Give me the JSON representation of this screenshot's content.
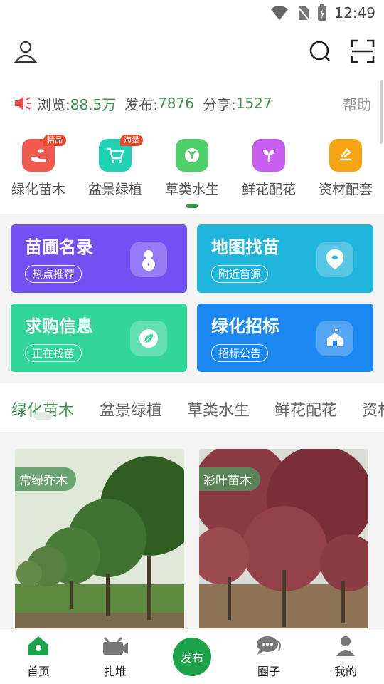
{
  "status": {
    "time": "12:49"
  },
  "stats": {
    "browse_label": "浏览:",
    "browse_value": "88.5万",
    "publish_label": "发布:",
    "publish_value": "7876",
    "share_label": "分享:",
    "share_value": "1527",
    "help": "帮助"
  },
  "categories": [
    {
      "label": "绿化苗木",
      "badge": "精品",
      "color": "#f25a4f"
    },
    {
      "label": "盆景绿植",
      "badge": "海量",
      "color": "#21d1b4"
    },
    {
      "label": "草类水生",
      "badge": "",
      "color": "#4fcf6a"
    },
    {
      "label": "鲜花配花",
      "badge": "",
      "color": "#c85ef0"
    },
    {
      "label": "资材配套",
      "badge": "",
      "color": "#f6a413"
    }
  ],
  "cards": [
    {
      "title": "苗圃名录",
      "sub": "热点推荐",
      "color": "#7350f1"
    },
    {
      "title": "地图找苗",
      "sub": "附近苗源",
      "color": "#20b5dc"
    },
    {
      "title": "求购信息",
      "sub": "正在找苗",
      "color": "#32d69b"
    },
    {
      "title": "绿化招标",
      "sub": "招标公告",
      "color": "#1b87f1"
    }
  ],
  "tabs": [
    "绿化苗木",
    "盆景绿植",
    "草类水生",
    "鲜花配花",
    "资材配套"
  ],
  "products": [
    {
      "tag": "常绿乔木"
    },
    {
      "tag": "彩叶苗木"
    }
  ],
  "nav": {
    "home": "首页",
    "pile": "扎堆",
    "publish": "发布",
    "circle": "圈子",
    "mine": "我的"
  },
  "colors": {
    "accent": "#3f8f4e",
    "publish_button": "#1ca34a"
  }
}
